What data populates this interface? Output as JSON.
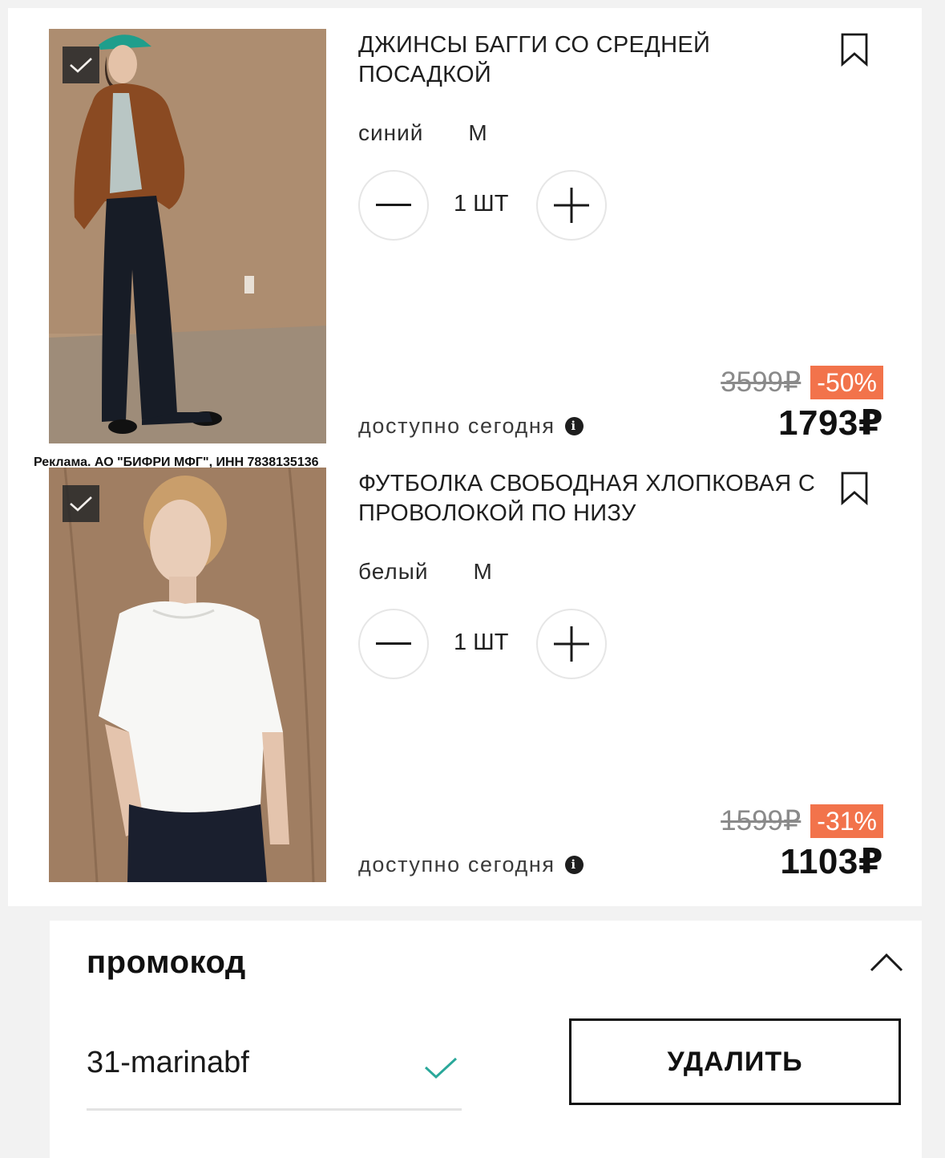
{
  "cart": {
    "items": [
      {
        "title": "ДЖИНСЫ БАГГИ СО СРЕДНЕЙ ПОСАДКОЙ",
        "color": "синий",
        "size": "M",
        "quantity": "1 ШТ",
        "availability": "доступно сегодня",
        "old_price": "3599₽",
        "discount": "-50%",
        "price": "1793₽",
        "selected": true,
        "image_icon": "model-wearing-baggy-jeans-photo"
      },
      {
        "title": "ФУТБОЛКА СВОБОДНАЯ ХЛОПКОВАЯ С ПРОВОЛОКОЙ ПО НИЗУ",
        "color": "белый",
        "size": "M",
        "quantity": "1 ШТ",
        "availability": "доступно сегодня",
        "old_price": "1599₽",
        "discount": "-31%",
        "price": "1103₽",
        "selected": true,
        "image_icon": "model-wearing-white-tshirt-photo"
      }
    ],
    "ad_label": "Реклама. АО \"БИФРИ МФГ\", ИНН 7838135136"
  },
  "promo": {
    "title": "промокод",
    "code": "31-marinabf",
    "delete_label": "УДАЛИТЬ"
  },
  "colors": {
    "discount_badge": "#f2734b",
    "promo_check": "#2aa89a",
    "text": "#1a1a1a"
  }
}
